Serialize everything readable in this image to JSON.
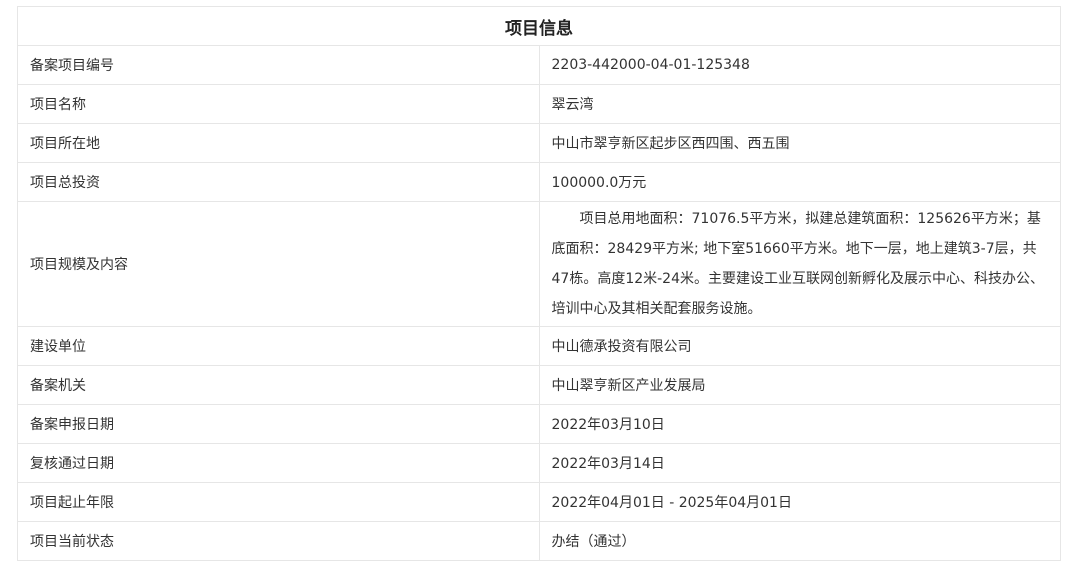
{
  "title": "项目信息",
  "rows": [
    {
      "label": "备案项目编号",
      "value": "2203-442000-04-01-125348"
    },
    {
      "label": "项目名称",
      "value": "翠云湾"
    },
    {
      "label": "项目所在地",
      "value": "中山市翠亨新区起步区西四围、西五围"
    },
    {
      "label": "项目总投资",
      "value": "100000.0万元"
    },
    {
      "label": "项目规模及内容",
      "value": "项目总用地面积：71076.5平方米，拟建总建筑面积：125626平方米；基底面积：28429平方米; 地下室51660平方米。地下一层，地上建筑3-7层，共47栋。高度12米-24米。主要建设工业互联网创新孵化及展示中心、科技办公、培训中心及其相关配套服务设施。"
    },
    {
      "label": "建设单位",
      "value": "中山德承投资有限公司"
    },
    {
      "label": "备案机关",
      "value": "中山翠亨新区产业发展局"
    },
    {
      "label": "备案申报日期",
      "value": "2022年03月10日"
    },
    {
      "label": "复核通过日期",
      "value": "2022年03月14日"
    },
    {
      "label": "项目起止年限",
      "value": "2022年04月01日 - 2025年04月01日"
    },
    {
      "label": "项目当前状态",
      "value": "办结（通过）"
    }
  ]
}
